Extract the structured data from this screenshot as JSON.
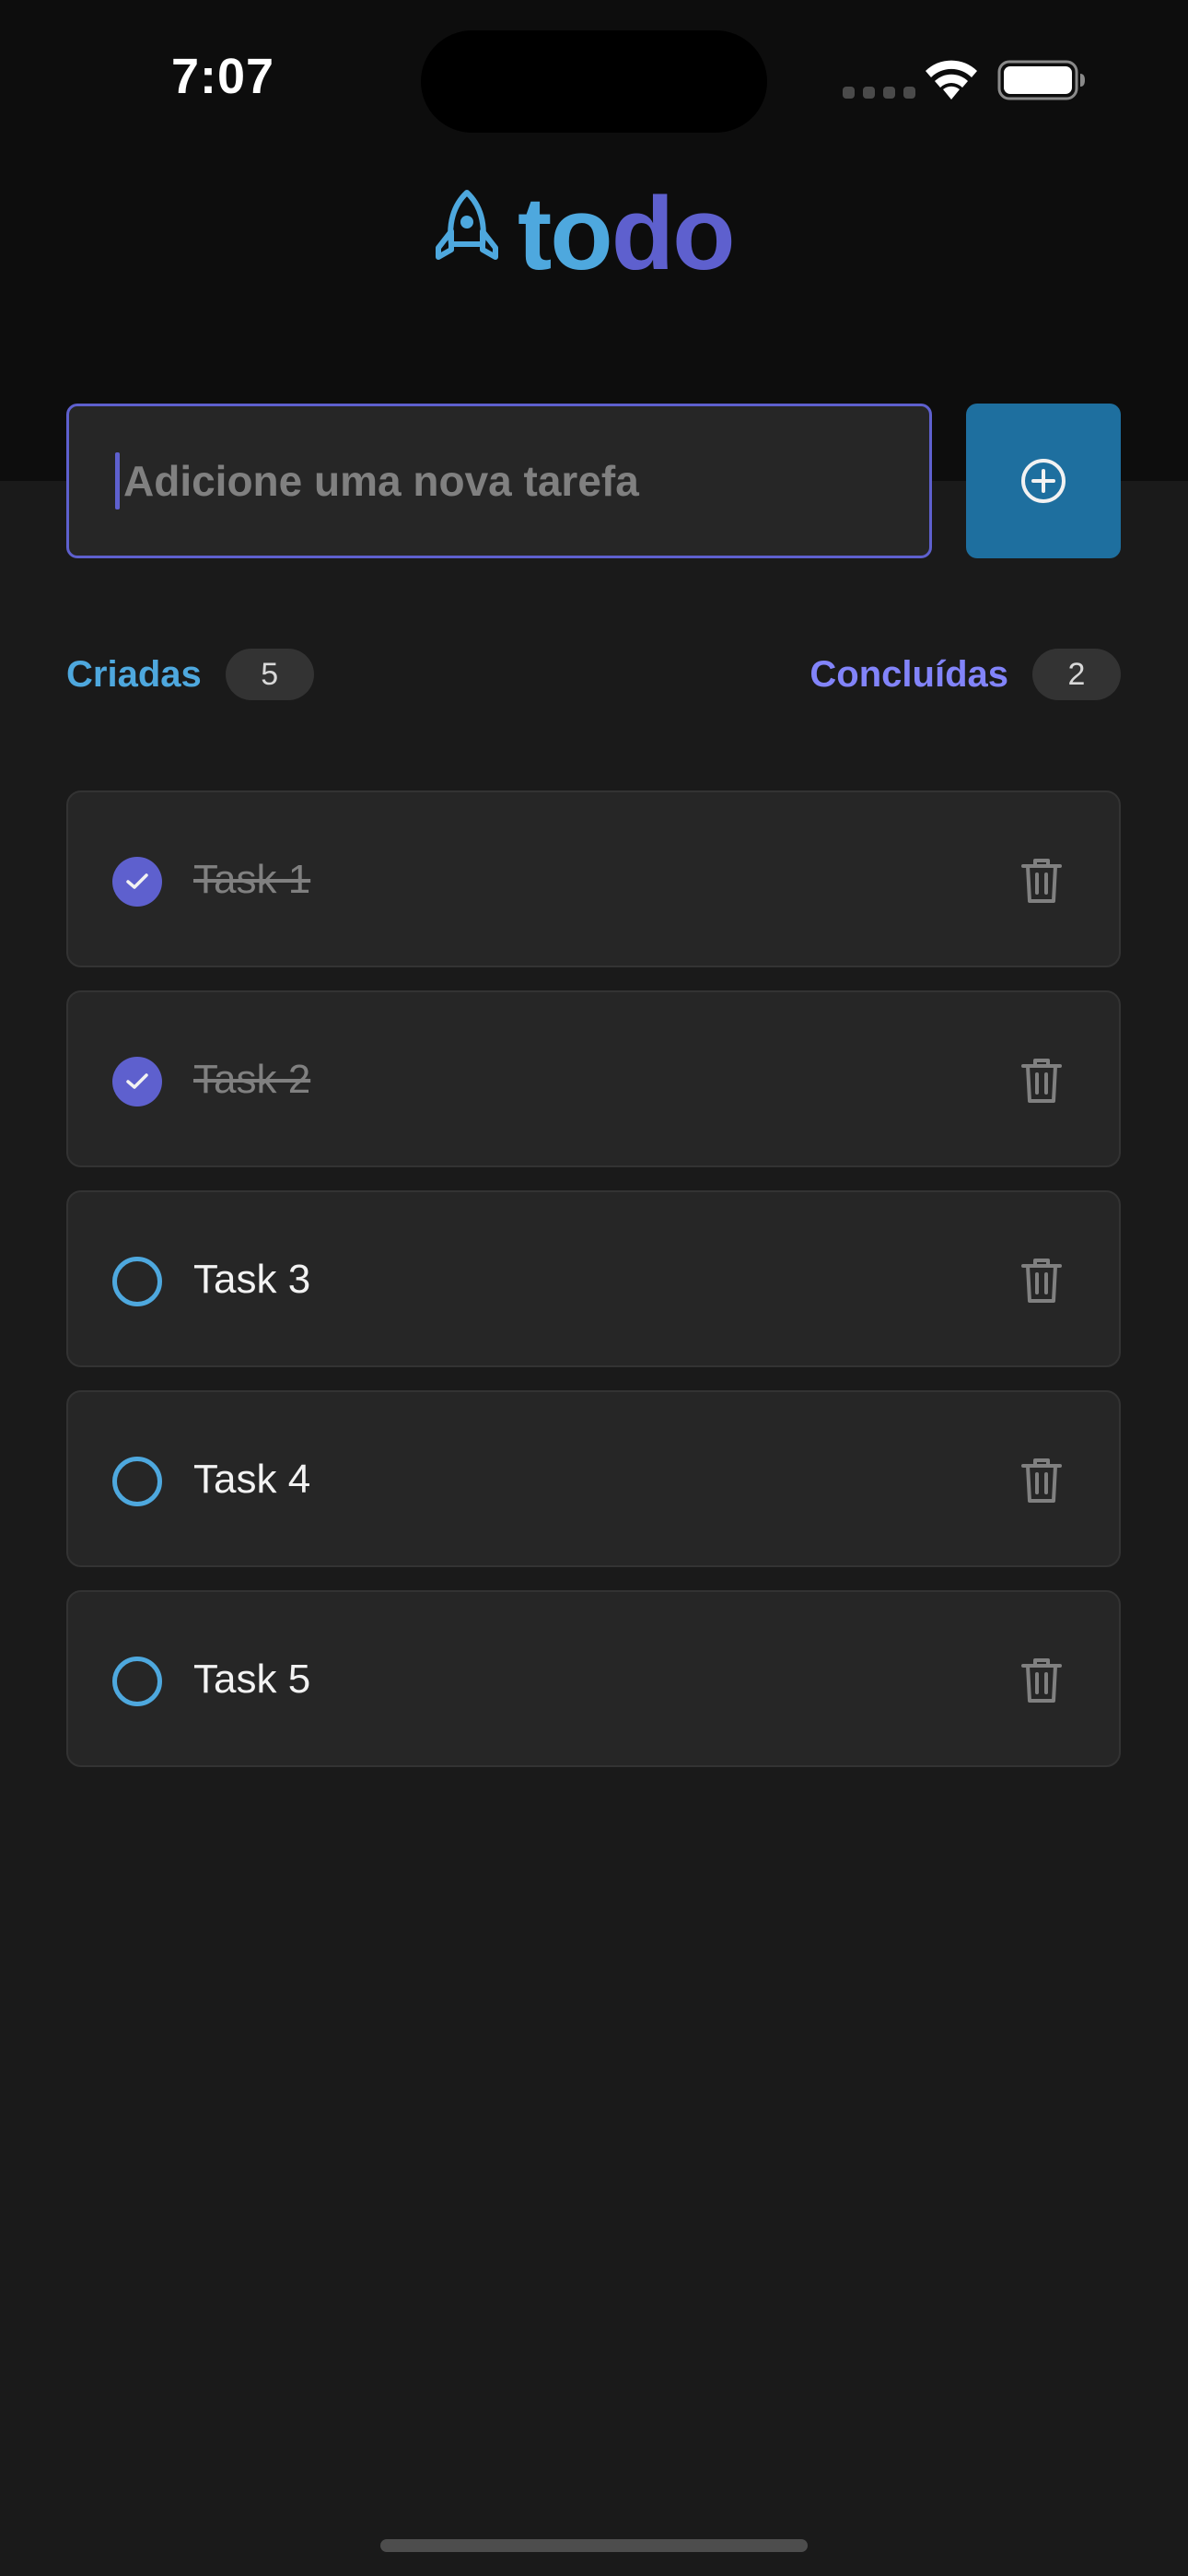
{
  "status_bar": {
    "time": "7:07"
  },
  "app": {
    "logo_part1": "to",
    "logo_part2": "do",
    "logo_icon": "rocket-icon",
    "accent_blue": "#4ea8de",
    "accent_purple": "#5e60ce"
  },
  "new_task": {
    "placeholder": "Adicione uma nova tarefa",
    "value": "",
    "add_button_icon": "plus-circle-icon"
  },
  "counters": {
    "created_label": "Criadas",
    "created_count": "5",
    "done_label": "Concluídas",
    "done_count": "2"
  },
  "tasks": [
    {
      "text": "Task 1",
      "done": true
    },
    {
      "text": "Task 2",
      "done": true
    },
    {
      "text": "Task 3",
      "done": false
    },
    {
      "text": "Task 4",
      "done": false
    },
    {
      "text": "Task 5",
      "done": false
    }
  ]
}
